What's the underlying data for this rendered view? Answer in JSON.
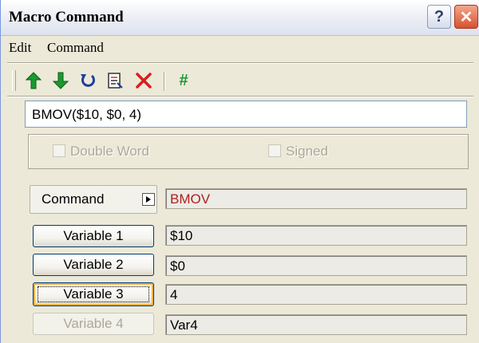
{
  "window": {
    "title": "Macro Command",
    "help_glyph": "?",
    "close_glyph": "✕"
  },
  "menu": {
    "items": [
      "Edit",
      "Command"
    ]
  },
  "toolbar": {
    "icons": [
      "move-up-icon",
      "move-down-icon",
      "undo-icon",
      "edit-document-icon",
      "delete-icon",
      "comment-hash-icon"
    ],
    "hash_glyph": "#"
  },
  "command_line": {
    "value": "BMOV($10, $0, 4)"
  },
  "options": {
    "double_word": "Double Word",
    "signed": "Signed",
    "double_word_checked": false,
    "signed_checked": false
  },
  "command": {
    "label": "Command",
    "value": "BMOV"
  },
  "variables": [
    {
      "label": "Variable 1",
      "value": "$10",
      "enabled": true
    },
    {
      "label": "Variable 2",
      "value": "$0",
      "enabled": true
    },
    {
      "label": "Variable 3",
      "value": "4",
      "enabled": true,
      "focused": true
    },
    {
      "label": "Variable 4",
      "value": "Var4",
      "enabled": false
    }
  ],
  "colors": {
    "accent_icon": "#1b9a2f",
    "delete_icon": "#d81e1e",
    "command_value": "#b0201c",
    "title_bar": "#e4e8f2"
  }
}
